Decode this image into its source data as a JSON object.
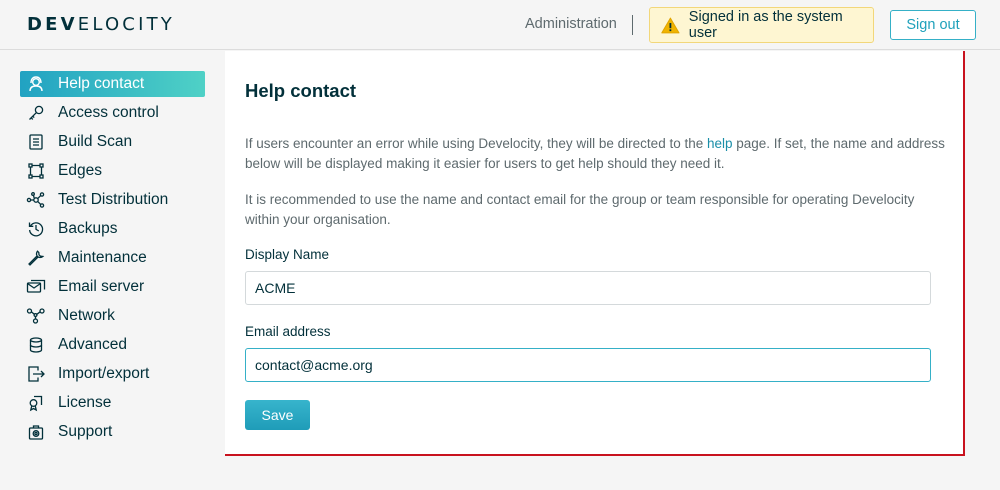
{
  "header": {
    "logo_bold": "DEV",
    "logo_rest": "ELOCITY",
    "admin_link": "Administration",
    "system_user_banner": "Signed in as the system user",
    "sign_out_label": "Sign out"
  },
  "sidebar": {
    "items": [
      {
        "label": "Help contact",
        "icon": "help-contact-icon",
        "active": true
      },
      {
        "label": "Access control",
        "icon": "key-icon"
      },
      {
        "label": "Build Scan",
        "icon": "document-list-icon"
      },
      {
        "label": "Edges",
        "icon": "edges-icon"
      },
      {
        "label": "Test Distribution",
        "icon": "network-nodes-icon"
      },
      {
        "label": "Backups",
        "icon": "history-icon"
      },
      {
        "label": "Maintenance",
        "icon": "wrench-icon"
      },
      {
        "label": "Email server",
        "icon": "email-icon"
      },
      {
        "label": "Network",
        "icon": "network-icon"
      },
      {
        "label": "Advanced",
        "icon": "database-icon"
      },
      {
        "label": "Import/export",
        "icon": "import-export-icon"
      },
      {
        "label": "License",
        "icon": "license-icon"
      },
      {
        "label": "Support",
        "icon": "support-icon"
      }
    ]
  },
  "main": {
    "title": "Help contact",
    "description_1_before": "If users encounter an error while using Develocity, they will be directed to the ",
    "description_1_link": "help",
    "description_1_after": " page. If set, the name and address below will be displayed making it easier for users to get help should they need it.",
    "description_2": "It is recommended to use the name and contact email for the group or team responsible for operating Develocity within your organisation.",
    "display_name_label": "Display Name",
    "display_name_value": "ACME",
    "email_label": "Email address",
    "email_value": "contact@acme.org",
    "save_label": "Save"
  },
  "colors": {
    "accent": "#1fa1bb",
    "active_gradient_start": "#21a2c2",
    "active_gradient_end": "#4fd1c6",
    "warning_bg": "#fef6d2",
    "warning_icon": "#f0b400",
    "panel_border": "#c8121e"
  }
}
